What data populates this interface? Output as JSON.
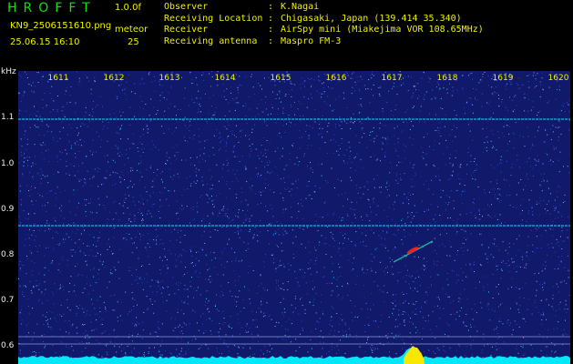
{
  "header": {
    "app_title": "HROFFT",
    "version": "1.0.0f",
    "filename": "KN9_2506151610.png",
    "count_label": "meteor",
    "datetime": "25.06.15 16:10",
    "count_value": "25",
    "info": [
      {
        "key": "Observer",
        "sep": ":",
        "value": "K.Nagai"
      },
      {
        "key": "Receiving Location",
        "sep": ":",
        "value": "Chigasaki, Japan (139.414 35.340)"
      },
      {
        "key": "Receiver",
        "sep": ":",
        "value": "AirSpy mini (Miakejima VOR 108.65MHz)"
      },
      {
        "key": "Receiving antenna",
        "sep": ":",
        "value": "Maspro FM-3"
      }
    ]
  },
  "spectrogram": {
    "unit": "kHz",
    "time_labels": [
      "1611",
      "1612",
      "1613",
      "1614",
      "1615",
      "1616",
      "1617",
      "1618",
      "1619",
      "1620"
    ],
    "freq_labels": [
      "1.1",
      "1.0",
      "0.9",
      "0.8",
      "0.7",
      "0.6"
    ],
    "background_color": "#10196a",
    "signal_color": "#20c8f0",
    "meteor_color": "#f02020",
    "level_color": "#00e8f8",
    "burst_color": "#f8e800"
  }
}
